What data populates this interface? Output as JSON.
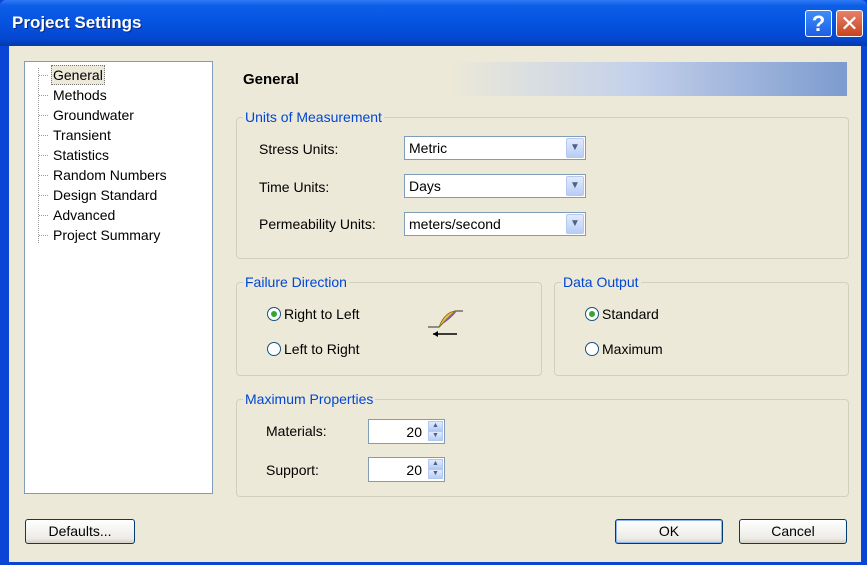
{
  "window": {
    "title": "Project Settings",
    "help_glyph": "?",
    "close_glyph": "✕"
  },
  "tree": {
    "items": [
      {
        "label": "General",
        "selected": true
      },
      {
        "label": "Methods"
      },
      {
        "label": "Groundwater"
      },
      {
        "label": "Transient"
      },
      {
        "label": "Statistics"
      },
      {
        "label": "Random Numbers"
      },
      {
        "label": "Design Standard"
      },
      {
        "label": "Advanced"
      },
      {
        "label": "Project Summary"
      }
    ]
  },
  "panel": {
    "heading": "General",
    "units": {
      "title": "Units of Measurement",
      "stress_label": "Stress Units:",
      "stress_value": "Metric",
      "time_label": "Time Units:",
      "time_value": "Days",
      "perm_label": "Permeability Units:",
      "perm_value": "meters/second"
    },
    "failure": {
      "title": "Failure Direction",
      "right_to_left": "Right to Left",
      "left_to_right": "Left to Right",
      "selected": "right_to_left"
    },
    "output": {
      "title": "Data Output",
      "standard": "Standard",
      "maximum": "Maximum",
      "selected": "standard"
    },
    "maxprops": {
      "title": "Maximum Properties",
      "materials_label": "Materials:",
      "materials_value": "20",
      "support_label": "Support:",
      "support_value": "20"
    }
  },
  "buttons": {
    "defaults": "Defaults...",
    "ok": "OK",
    "cancel": "Cancel"
  },
  "colors": {
    "titlebar": "#0553e0",
    "group_title": "#0046d5",
    "dialog_bg": "#ece9d8"
  }
}
